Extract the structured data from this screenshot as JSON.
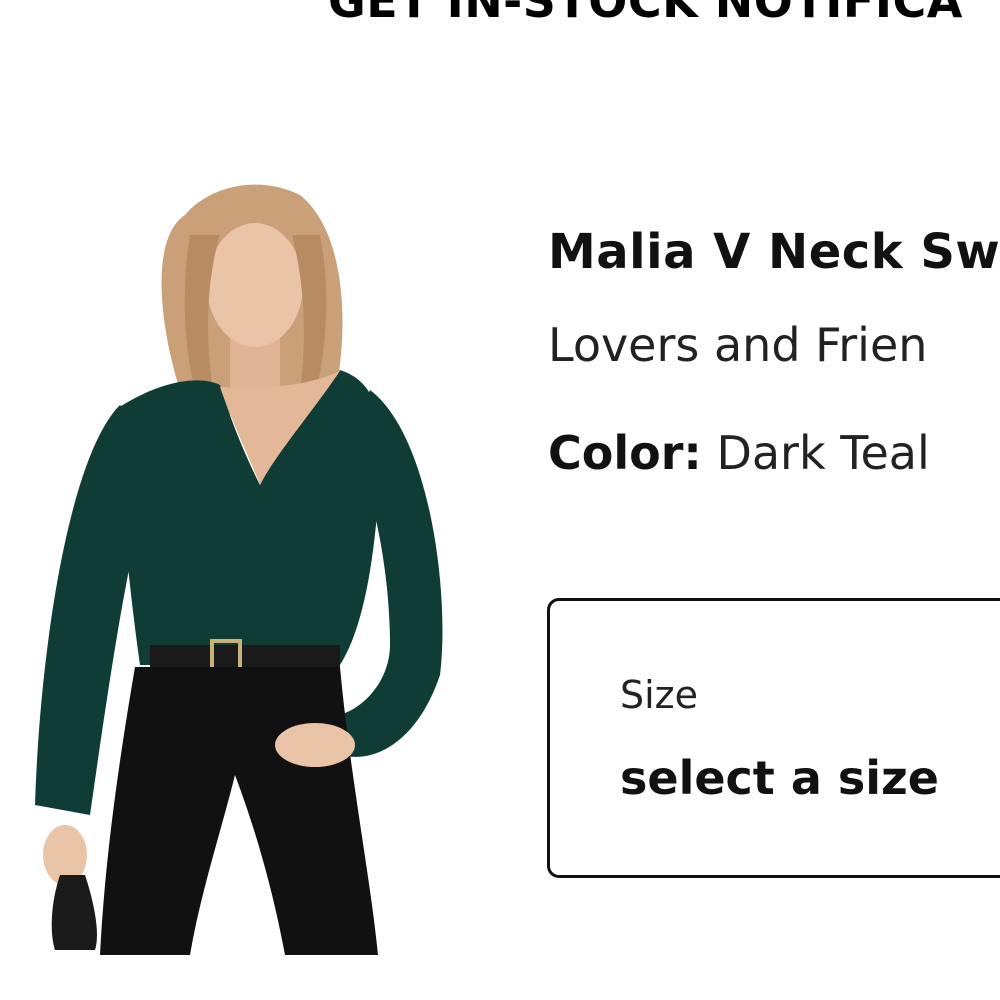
{
  "notify": {
    "heading": "GET IN-STOCK NOTIFICA"
  },
  "product": {
    "name": "Malia V Neck Sw",
    "brand": "Lovers and Frien",
    "color_label": "Color:",
    "color_value": "Dark Teal",
    "image_colors": {
      "sweater": "#0f3d36",
      "pants": "#111111",
      "hair": "#c9a077",
      "skin": "#e9c4a6"
    }
  },
  "size_selector": {
    "label": "Size",
    "value": "select a size"
  }
}
